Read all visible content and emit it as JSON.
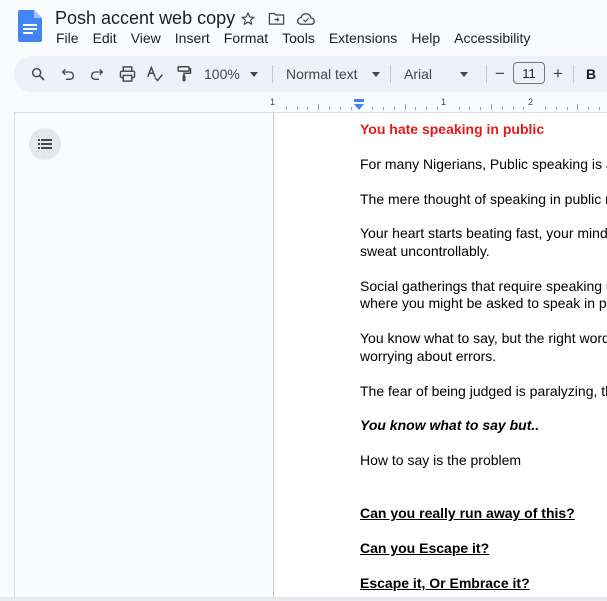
{
  "app": {
    "doc_title": "Posh accent web copy",
    "menu": [
      "File",
      "Edit",
      "View",
      "Insert",
      "Format",
      "Tools",
      "Extensions",
      "Help",
      "Accessibility"
    ]
  },
  "toolbar": {
    "zoom": "100%",
    "style": "Normal text",
    "font": "Arial",
    "font_size": "11",
    "bold": "B",
    "minus": "−",
    "plus": "+"
  },
  "ruler": {
    "labels": [
      "1",
      "1",
      "2"
    ]
  },
  "document": {
    "heading": "You hate speaking in public",
    "p1": "For many Nigerians, Public speaking is a r",
    "p2": "The mere thought of speaking in public ma",
    "p3_line1": "Your heart starts beating fast, your mind go",
    "p3_line2": "sweat uncontrollably.",
    "p4_line1": "Social gatherings that require speaking up",
    "p4_line2": "where you might be asked to speak in pub",
    "p5_line1": "You know what to say, but the right words t",
    "p5_line2": "worrying about errors.",
    "p6": "The fear of being judged is paralyzing, that",
    "p7": "You know what to say but..",
    "p8": "How to say is the problem",
    "h1": "Can you really run away of this?",
    "h2": "Can you Escape it?",
    "h3": "Escape it, Or Embrace it?"
  },
  "colors": {
    "heading_red": "#e11b1b",
    "docs_blue": "#4285f4"
  }
}
